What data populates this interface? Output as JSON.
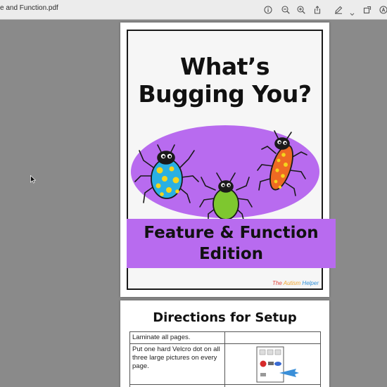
{
  "viewer": {
    "document_title": "e and Function.pdf",
    "toolbar_icons": [
      "info-icon",
      "zoom-out-icon",
      "zoom-in-icon",
      "share-icon",
      "markup-pen-icon",
      "chevron-down-icon",
      "rotate-icon",
      "highlight-icon"
    ]
  },
  "page1": {
    "title_line1": "What’s",
    "title_line2": "Bugging You?",
    "subtitle_line1": "Feature & Function",
    "subtitle_line2": "Edition",
    "logo_part1": "The ",
    "logo_part2": "Autism",
    "logo_part3": " Helper",
    "colors": {
      "oval": "#b86bef",
      "band": "#b86bef",
      "bug_blue": "#2ab0e3",
      "bug_green": "#7ec72f",
      "bug_orange": "#ee6a23"
    }
  },
  "page2": {
    "title": "Directions for Setup",
    "rows": [
      {
        "text": "Laminate all pages.",
        "has_image": false
      },
      {
        "text": "Put one hard Velcro dot on all three large pictures on every page.",
        "has_image": true
      },
      {
        "text": "",
        "has_image": false
      }
    ]
  }
}
